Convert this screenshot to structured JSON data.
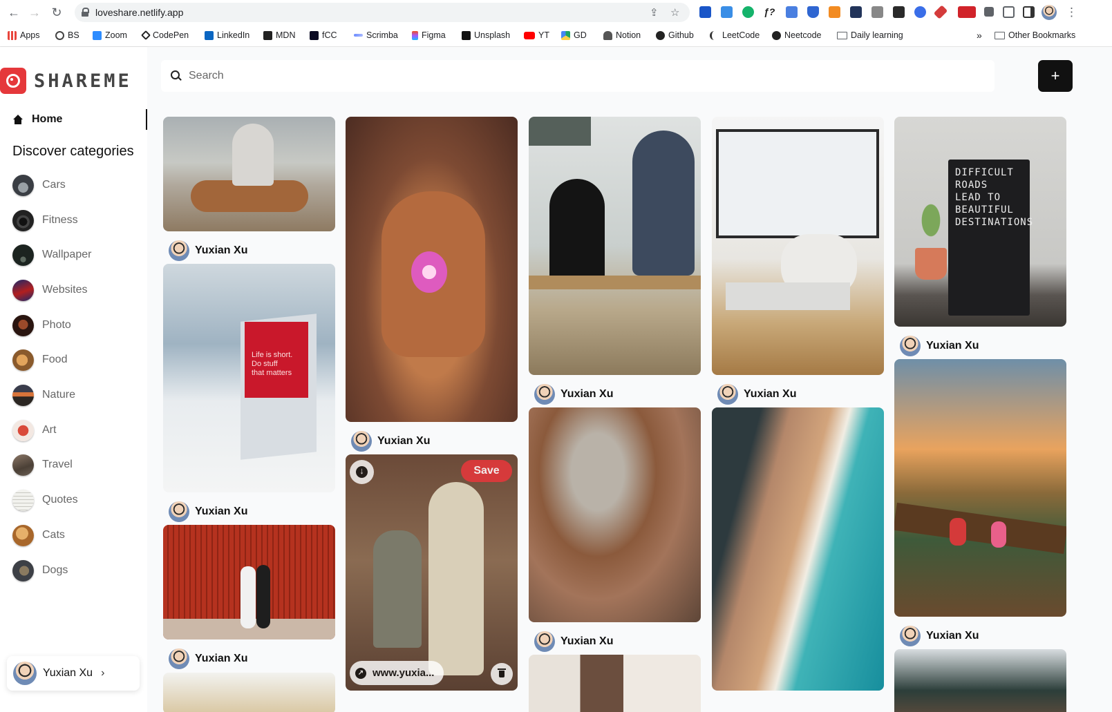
{
  "browser": {
    "url": "loveshare.netlify.app",
    "bookmarks": [
      "Apps",
      "BS",
      "Zoom",
      "CodePen",
      "LinkedIn",
      "MDN",
      "fCC",
      "Scrimba",
      "Figma",
      "Unsplash",
      "YT",
      "GD",
      "Notion",
      "Github",
      "LeetCode",
      "Neetcode",
      "Daily learning"
    ],
    "overflow": "»",
    "other_bookmarks": "Other Bookmarks"
  },
  "app": {
    "logo_text": "SHAREME",
    "brand_color": "#e5383b"
  },
  "sidebar": {
    "home_label": "Home",
    "categories_title": "Discover categories",
    "categories": [
      "Cars",
      "Fitness",
      "Wallpaper",
      "Websites",
      "Photo",
      "Food",
      "Nature",
      "Art",
      "Travel",
      "Quotes",
      "Cats",
      "Dogs"
    ],
    "user_name": "Yuxian Xu"
  },
  "header": {
    "search_placeholder": "Search",
    "add_button": "+"
  },
  "pins": {
    "author": "Yuxian Xu",
    "save_label": "Save",
    "link_text": "www.yuxia...",
    "quote_board": "DIFFICULT\nROADS\nLEAD TO\nBEAUTIFUL\nDESTINATIONS",
    "calendar_text": "Life is short.\nDo stuff\nthat matters"
  }
}
